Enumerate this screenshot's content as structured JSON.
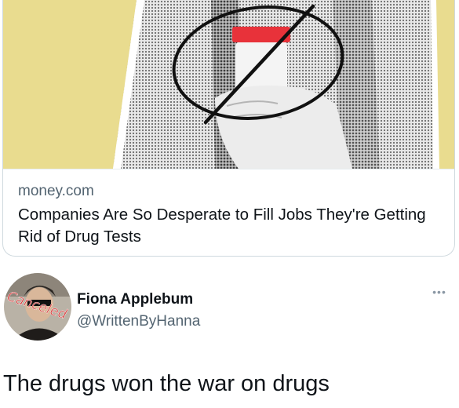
{
  "link_card": {
    "domain": "money.com",
    "title": "Companies Are So Desperate to Fill Jobs They're Getting Rid of Drug Tests",
    "image_icon": "drug-test-cup-crossed-out-image"
  },
  "tweet": {
    "display_name": "Fiona Applebum",
    "handle": "@WrittenByHanna",
    "more_icon": "more-dots-icon",
    "more_label": "•••",
    "avatar_text": "Canceled",
    "text": "The drugs won the war on drugs"
  },
  "colors": {
    "image_background": "#e9dc8f",
    "cup_lid": "#e8323a",
    "secondary_text": "#536471",
    "border": "#cfd9de"
  }
}
